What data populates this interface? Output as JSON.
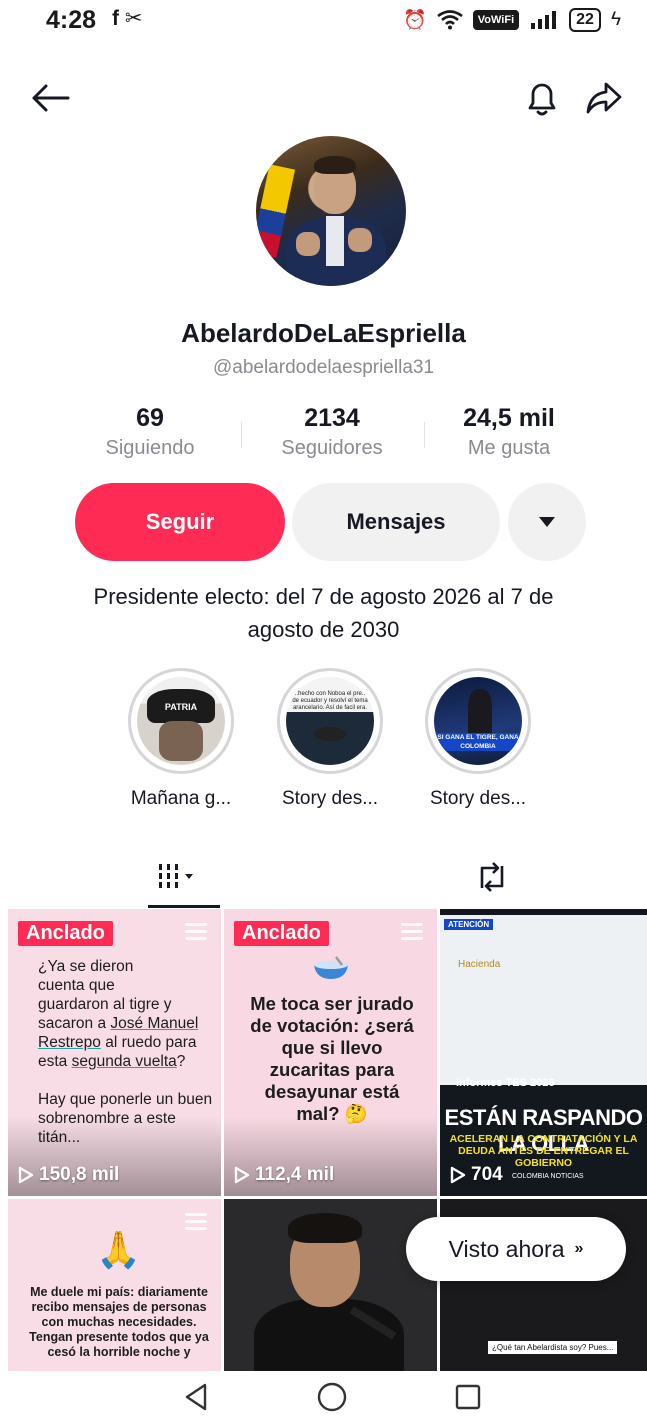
{
  "status_bar": {
    "time": "4:28",
    "left_icons": "f  ✂",
    "vowifi": "VoWiFi",
    "battery": "22"
  },
  "profile": {
    "display_name": "AbelardoDeLaEspriella",
    "username": "@abelardodelaespriella31",
    "stats": {
      "following_count": "69",
      "following_label": "Siguiendo",
      "followers_count": "2134",
      "followers_label": "Seguidores",
      "likes_count": "24,5 mil",
      "likes_label": "Me gusta"
    },
    "buttons": {
      "follow": "Seguir",
      "message": "Mensajes"
    },
    "bio": "Presidente electo: del 7 de agosto 2026 al 7 de agosto de 2030"
  },
  "highlights": [
    {
      "label": "Mañana g...",
      "thumb_text": "PATRIA"
    },
    {
      "label": "Story des...",
      "thumb_text": "...hecho con Noboa el pre... de ecuador y resolví el tema arancelario. Así de facil era."
    },
    {
      "label": "Story des...",
      "thumb_text": "SI GANA EL TIGRE, GANA COLOMBIA"
    }
  ],
  "videos": [
    {
      "pinned_label": "Anclado",
      "views": "150,8 mil",
      "text_lines": [
        "¿Ya se dieron",
        "cuenta que",
        "guardaron al tigre y",
        "sacaron a "
      ],
      "underlined_1": "José Manuel Restrepo",
      "text_mid": " al ruedo para esta ",
      "underlined_2": "segunda vuelta",
      "text_end": "?",
      "text_2": "Hay que ponerle un buen sobrenombre a este titán..."
    },
    {
      "pinned_label": "Anclado",
      "views": "112,4 mil",
      "text": "Me toca ser jurado de votación: ¿será que si llevo zucaritas para desayunar está mal? 🤔"
    },
    {
      "views": "704",
      "attention": "ATENCIÓN",
      "hacienda": "Hacienda",
      "informes": "Informes TES 2026",
      "headline": "ESTÁN RASPANDO LA OLLA",
      "sub": "ACELERAN LA CONTRATACIÓN Y LA DEUDA ANTES DE ENTREGAR EL GOBIERNO",
      "source": "COLOMBIA NOTICIAS"
    },
    {
      "emoji": "🙏",
      "text": "Me duele mi país: diariamente recibo mensajes de personas con muchas necesidades. Tengan presente todos que ya cesó la horrible noche y"
    },
    {},
    {
      "caption": "¿Qué tan Abelardista soy? Pues..."
    }
  ],
  "visto_ahora": {
    "label": "Visto ahora"
  },
  "colors": {
    "accent": "#fe2c55",
    "text_primary": "#161823",
    "text_secondary": "#8a8b91",
    "button_secondary": "#f1f1f2"
  }
}
